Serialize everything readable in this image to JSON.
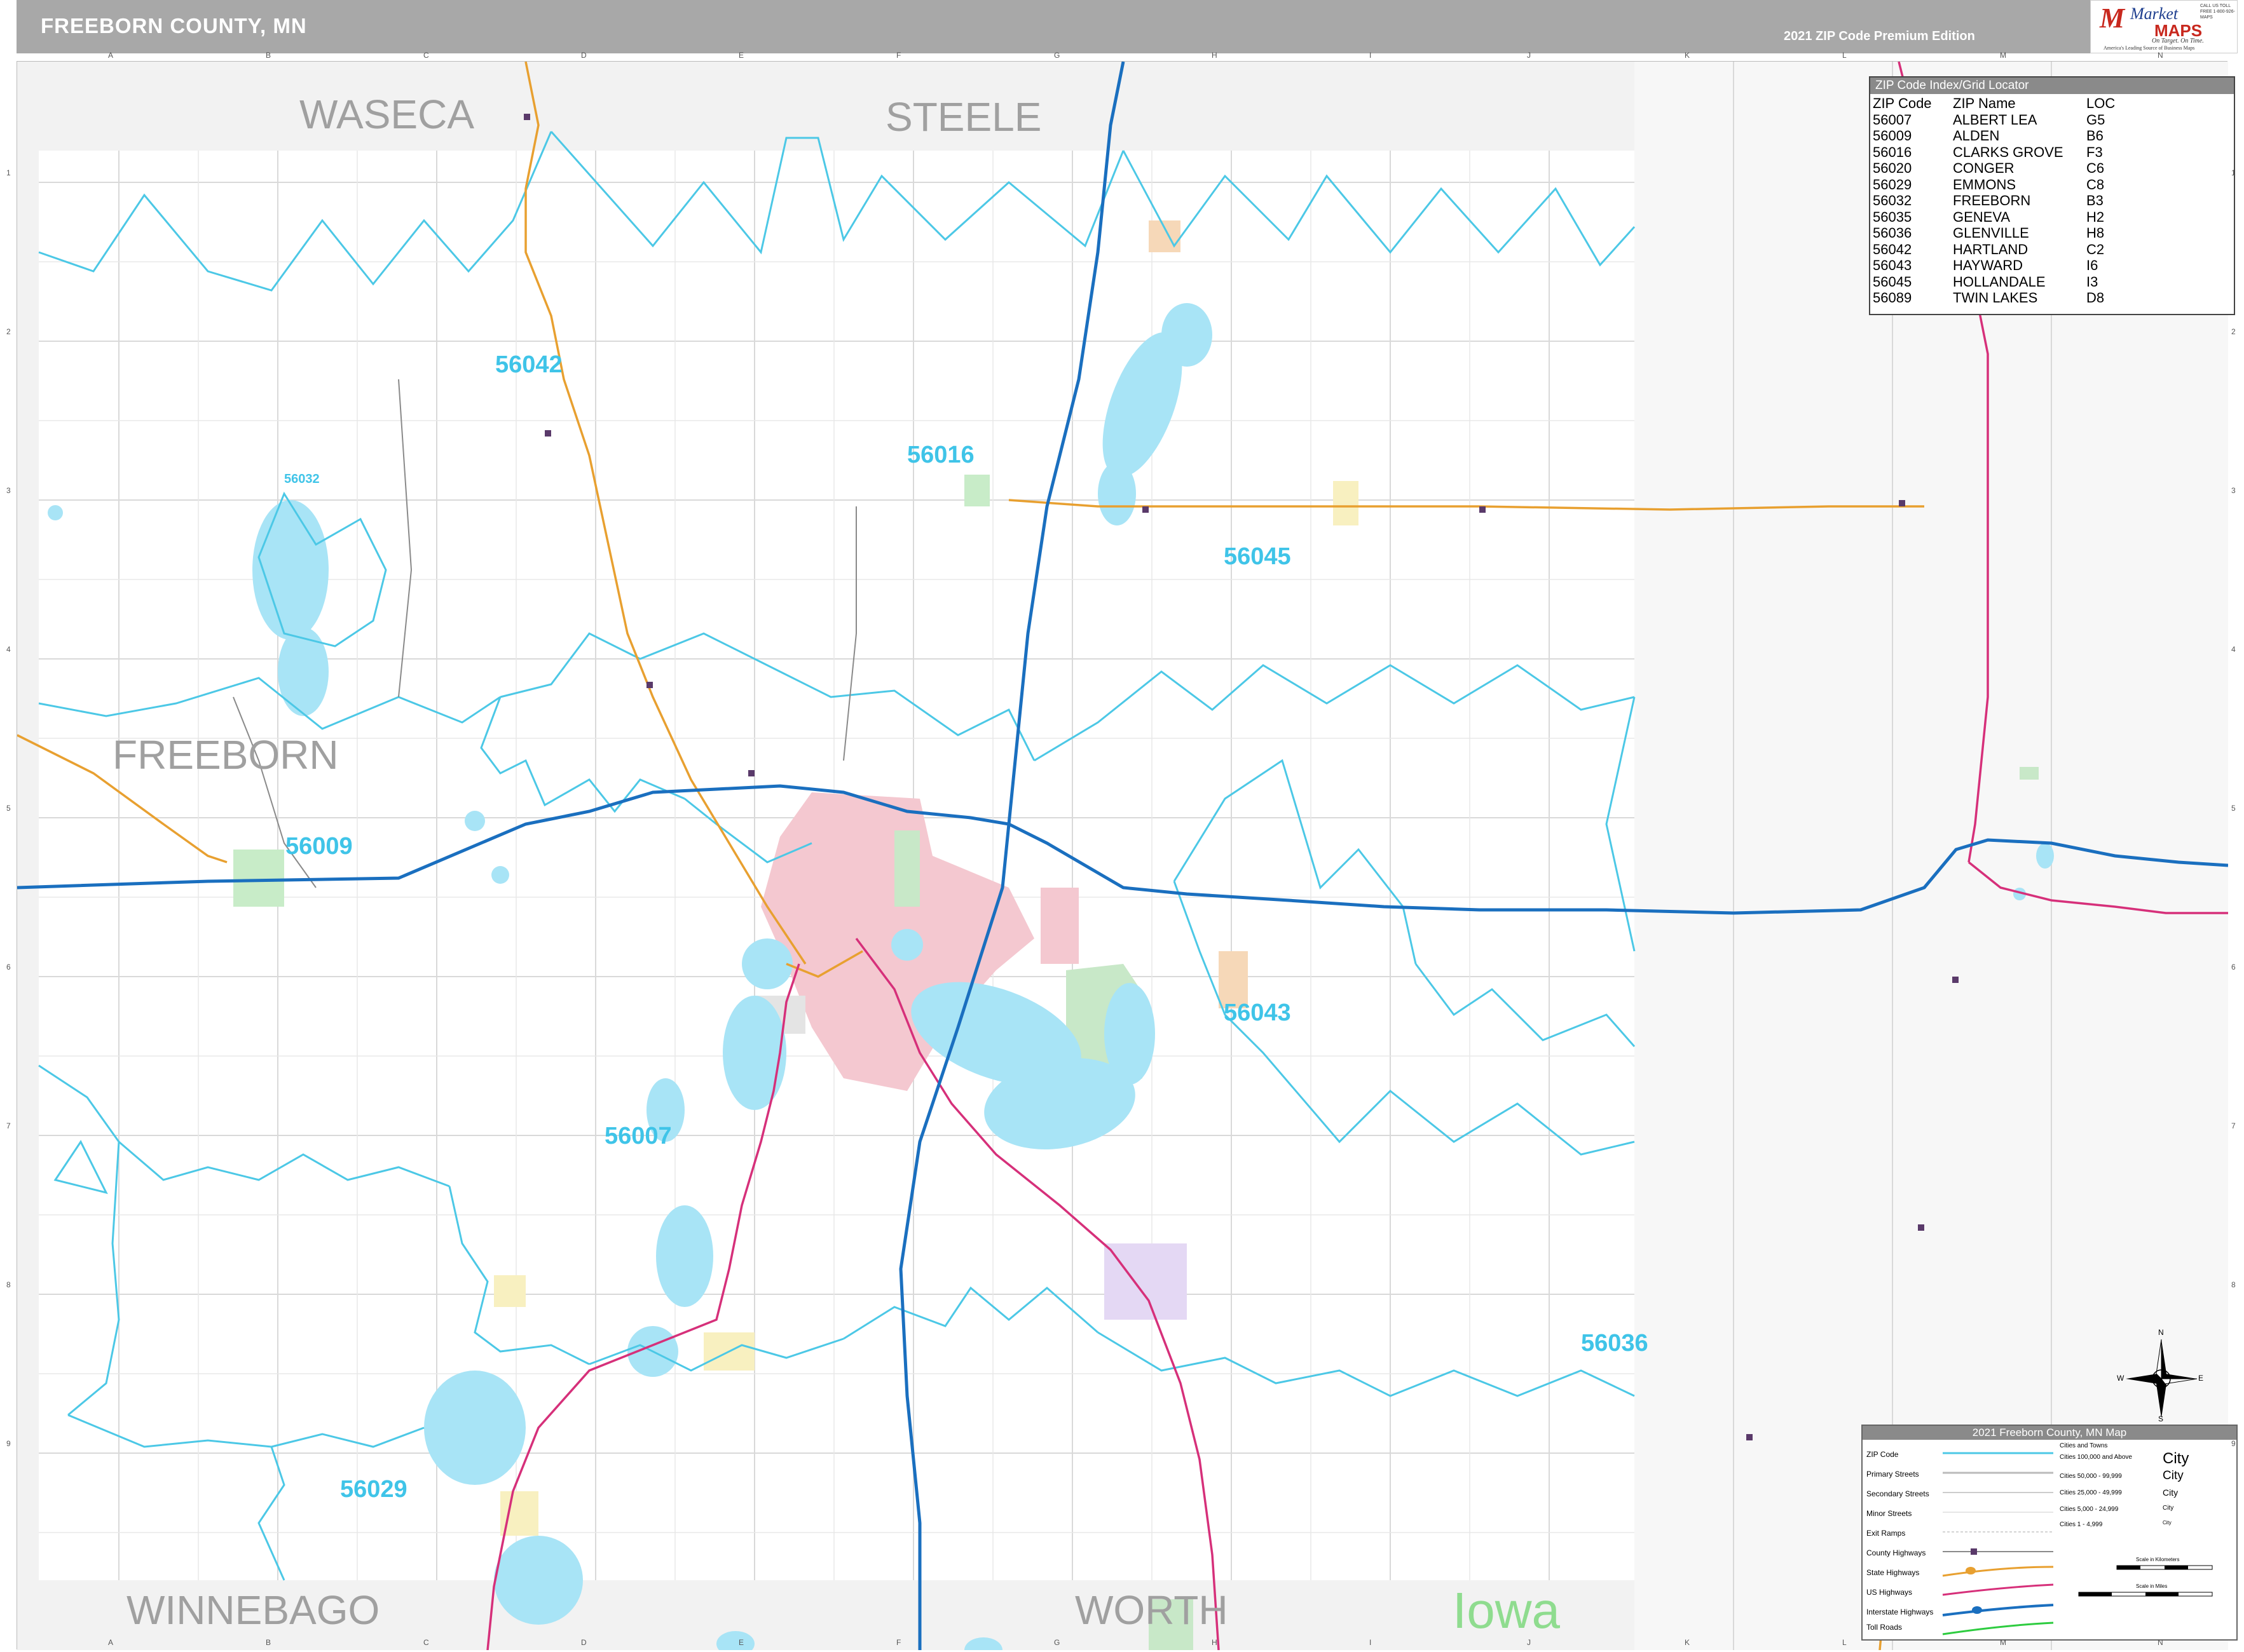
{
  "header": {
    "title": "FREEBORN COUNTY, MN",
    "edition": "2021 ZIP Code Premium Edition",
    "logo": {
      "brand_top": "Market",
      "brand_bottom": "MAPS",
      "tagline": "On Target. On Time.",
      "slogan": "America's Leading Source of Business Maps",
      "contact": "CALL US TOLL FREE 1-800-926-MAPS"
    }
  },
  "grid": {
    "columns": [
      "A",
      "B",
      "C",
      "D",
      "E",
      "F",
      "G",
      "H",
      "I",
      "J",
      "K",
      "L",
      "M",
      "N"
    ],
    "rows": [
      "1",
      "2",
      "3",
      "4",
      "5",
      "6",
      "7",
      "8",
      "9"
    ]
  },
  "counties": {
    "waseca": "WASECA",
    "steele": "STEELE",
    "freeborn": "FREEBORN",
    "winnebago": "WINNEBAGO",
    "worth": "WORTH"
  },
  "state_label": "Iowa",
  "zip_labels": {
    "z56042": "56042",
    "z56016": "56016",
    "z56045": "56045",
    "z56009": "56009",
    "z56043": "56043",
    "z56007": "56007",
    "z56036": "56036",
    "z56029": "56029",
    "z56032_small": "56032"
  },
  "zip_index": {
    "title": "ZIP Code Index/Grid Locator",
    "headers": [
      "ZIP Code",
      "ZIP Name",
      "LOC"
    ],
    "rows": [
      [
        "56007",
        "ALBERT LEA",
        "G5"
      ],
      [
        "56009",
        "ALDEN",
        "B6"
      ],
      [
        "56016",
        "CLARKS GROVE",
        "F3"
      ],
      [
        "56020",
        "CONGER",
        "C6"
      ],
      [
        "56029",
        "EMMONS",
        "C8"
      ],
      [
        "56032",
        "FREEBORN",
        "B3"
      ],
      [
        "56035",
        "GENEVA",
        "H2"
      ],
      [
        "56036",
        "GLENVILLE",
        "H8"
      ],
      [
        "56042",
        "HARTLAND",
        "C2"
      ],
      [
        "56043",
        "HAYWARD",
        "I6"
      ],
      [
        "56045",
        "HOLLANDALE",
        "I3"
      ],
      [
        "56089",
        "TWIN LAKES",
        "D8"
      ]
    ]
  },
  "legend": {
    "title": "2021 Freeborn County, MN Map",
    "items": [
      "ZIP Code",
      "Primary Streets",
      "Secondary Streets",
      "Minor Streets",
      "Exit Ramps",
      "County Highways",
      "State Highways",
      "US Highways",
      "Interstate Highways",
      "Toll Roads"
    ],
    "cities_heading": "Cities and Towns",
    "city_classes": [
      "Cities 100,000 and Above",
      "Cities 50,000 - 99,999",
      "Cities 25,000 - 49,999",
      "Cities 5,000 - 24,999",
      "Cities 1 - 4,999"
    ],
    "city_samples": [
      "City",
      "City",
      "City",
      "City",
      "City"
    ],
    "scale_km": "Scale in Kilometers",
    "scale_mi": "Scale in Miles"
  },
  "compass": {
    "n": "N",
    "s": "S",
    "e": "E",
    "w": "W"
  },
  "colors": {
    "zip_boundary": "#4cc8e6",
    "interstate": "#1a6fbf",
    "us_highway": "#d6307a",
    "state_highway": "#e8a030",
    "water": "#a8e4f6",
    "urban": "#f4c8d0",
    "park": "#c8e8c8",
    "county_label": "#a0a0a0",
    "zip_label": "#3fc4e8"
  }
}
